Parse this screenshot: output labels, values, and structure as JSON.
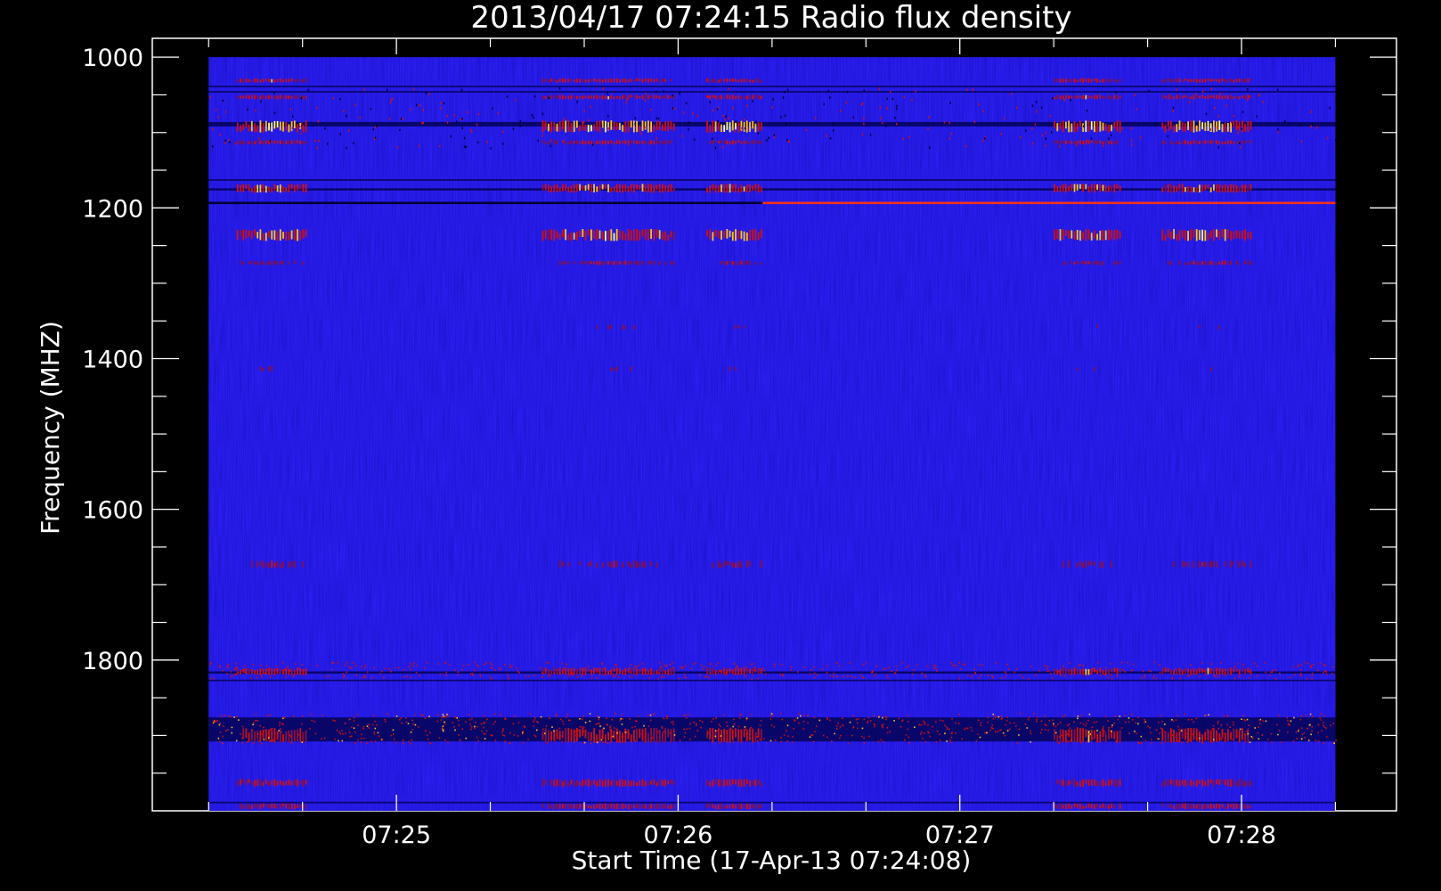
{
  "chart_data": {
    "type": "heatmap",
    "title": "2013/04/17 07:24:15 Radio flux density",
    "xlabel": "Start Time (17-Apr-13 07:24:08)",
    "ylabel": "Frequency (MHZ)",
    "x_major_ticks": [
      {
        "label": "07:25",
        "seconds": 52
      },
      {
        "label": "07:26",
        "seconds": 112
      },
      {
        "label": "07:27",
        "seconds": 172
      },
      {
        "label": "07:28",
        "seconds": 232
      }
    ],
    "x_minor_tick_seconds": [
      12,
      32,
      72,
      92,
      132,
      152,
      192,
      212,
      252
    ],
    "xlim_seconds": [
      0,
      265
    ],
    "data_x_range_seconds": [
      12,
      252
    ],
    "y_major_ticks": [
      1000,
      1200,
      1400,
      1600,
      1800
    ],
    "y_minor_ticks": [
      1050,
      1100,
      1150,
      1250,
      1300,
      1350,
      1450,
      1500,
      1550,
      1650,
      1700,
      1750,
      1850,
      1900,
      1950
    ],
    "ylim": [
      975,
      2000
    ],
    "data_y_range": [
      1000,
      2000
    ],
    "y_inverted": true,
    "colors": {
      "background": "#000000",
      "axes": "#ffffff",
      "baseline": "#2a1ef0",
      "low": "#000040",
      "mid": "#d01010",
      "high": "#ffc020",
      "peak": "#ffff80"
    },
    "burst_times_seconds": [
      [
        18,
        33
      ],
      [
        83,
        111
      ],
      [
        118,
        130
      ],
      [
        192,
        206
      ],
      [
        215,
        234
      ]
    ],
    "emission_bands_mhz": [
      {
        "from": 1028,
        "to": 1034,
        "intensity": 0.55
      },
      {
        "from": 1050,
        "to": 1056,
        "intensity": 0.55
      },
      {
        "from": 1084,
        "to": 1100,
        "intensity": 0.95
      },
      {
        "from": 1110,
        "to": 1116,
        "intensity": 0.45
      },
      {
        "from": 1168,
        "to": 1180,
        "intensity": 0.75
      },
      {
        "from": 1228,
        "to": 1244,
        "intensity": 0.85
      },
      {
        "from": 1270,
        "to": 1276,
        "intensity": 0.35
      },
      {
        "from": 1355,
        "to": 1362,
        "intensity": 0.2
      },
      {
        "from": 1410,
        "to": 1417,
        "intensity": 0.2
      },
      {
        "from": 1668,
        "to": 1678,
        "intensity": 0.3
      },
      {
        "from": 1810,
        "to": 1820,
        "intensity": 0.55
      },
      {
        "from": 1890,
        "to": 1910,
        "intensity": 0.55
      },
      {
        "from": 1958,
        "to": 1968,
        "intensity": 0.5
      },
      {
        "from": 1990,
        "to": 1998,
        "intensity": 0.5
      }
    ],
    "continuous_bands_mhz": [
      {
        "from": 1038,
        "to": 1040,
        "kind": "dark"
      },
      {
        "from": 1045,
        "to": 1047,
        "kind": "dark"
      },
      {
        "from": 1086,
        "to": 1092,
        "kind": "dark"
      },
      {
        "from": 1162,
        "to": 1164,
        "kind": "dark"
      },
      {
        "from": 1174,
        "to": 1177,
        "kind": "dark"
      },
      {
        "from": 1192,
        "to": 1195,
        "kind": "line"
      },
      {
        "from": 1815,
        "to": 1818,
        "kind": "dark"
      },
      {
        "from": 1826,
        "to": 1828,
        "kind": "dark"
      },
      {
        "from": 1876,
        "to": 1908,
        "kind": "dark"
      },
      {
        "from": 1988,
        "to": 1990,
        "kind": "dark"
      }
    ]
  }
}
